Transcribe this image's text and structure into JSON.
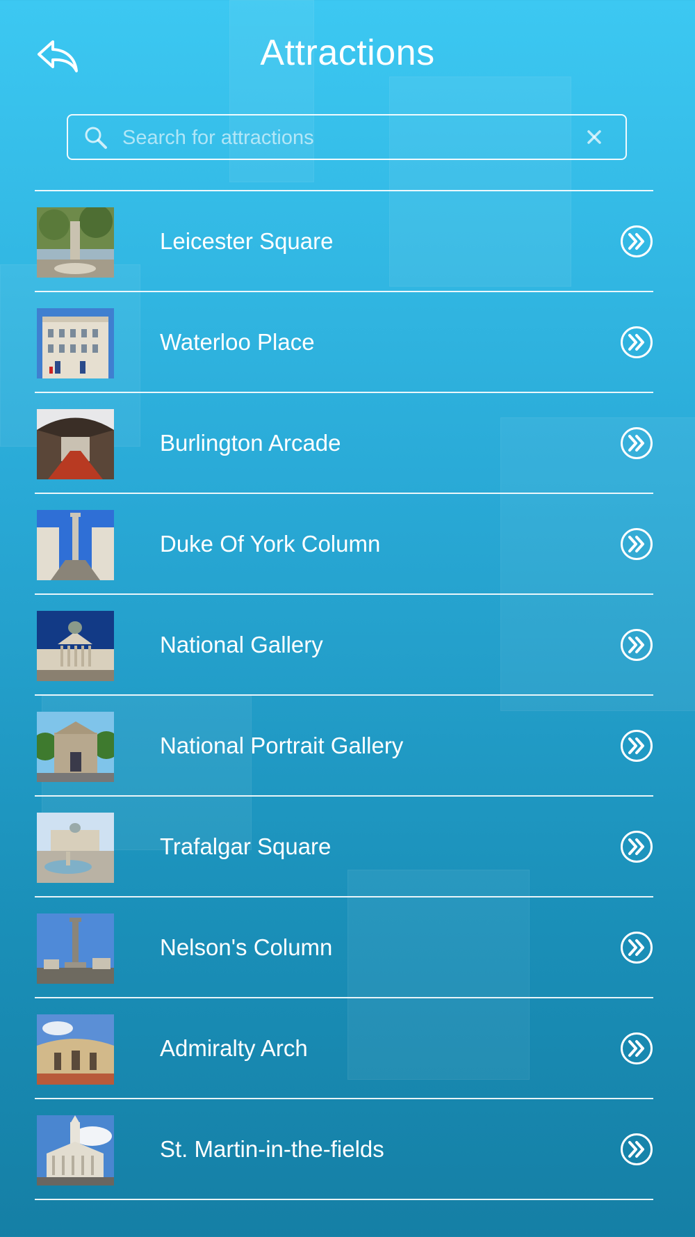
{
  "header": {
    "title": "Attractions",
    "back_icon": "reply-arrow-icon"
  },
  "search": {
    "placeholder": "Search for attractions",
    "value": "",
    "icon": "search-icon",
    "clear_icon": "close-icon"
  },
  "attractions": [
    {
      "label": "Leicester Square",
      "icon": "double-chevron-right-icon"
    },
    {
      "label": "Waterloo Place",
      "icon": "double-chevron-right-icon"
    },
    {
      "label": "Burlington Arcade",
      "icon": "double-chevron-right-icon"
    },
    {
      "label": "Duke Of York Column",
      "icon": "double-chevron-right-icon"
    },
    {
      "label": "National Gallery",
      "icon": "double-chevron-right-icon"
    },
    {
      "label": "National Portrait Gallery",
      "icon": "double-chevron-right-icon"
    },
    {
      "label": "Trafalgar Square",
      "icon": "double-chevron-right-icon"
    },
    {
      "label": "Nelson's Column",
      "icon": "double-chevron-right-icon"
    },
    {
      "label": "Admiralty Arch",
      "icon": "double-chevron-right-icon"
    },
    {
      "label": "St. Martin-in-the-fields",
      "icon": "double-chevron-right-icon"
    }
  ],
  "colors": {
    "background_top": "#3cc8f2",
    "background_bottom": "#157fa5",
    "foreground": "#ffffff"
  }
}
